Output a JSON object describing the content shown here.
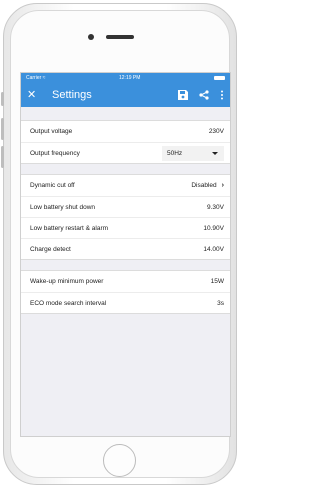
{
  "status_bar": {
    "carrier": "Carrier",
    "time": "12:19 PM"
  },
  "app_bar": {
    "title": "Settings",
    "close_icon": "close-icon",
    "save_icon": "save-icon",
    "share_icon": "share-icon",
    "more_icon": "more-vert-icon"
  },
  "groups": [
    {
      "rows": [
        {
          "label": "Output voltage",
          "value": "230V"
        },
        {
          "label": "Output frequency",
          "value": "50Hz"
        }
      ]
    },
    {
      "rows": [
        {
          "label": "Dynamic cut off",
          "value": "Disabled"
        },
        {
          "label": "Low battery shut down",
          "value": "9.30V"
        },
        {
          "label": "Low battery restart & alarm",
          "value": "10.90V"
        },
        {
          "label": "Charge detect",
          "value": "14.00V"
        }
      ]
    },
    {
      "rows": [
        {
          "label": "Wake-up minimum power",
          "value": "15W"
        },
        {
          "label": "ECO mode search interval",
          "value": "3s"
        }
      ]
    }
  ],
  "colors": {
    "accent": "#3b90dc",
    "background": "#efeff4"
  }
}
